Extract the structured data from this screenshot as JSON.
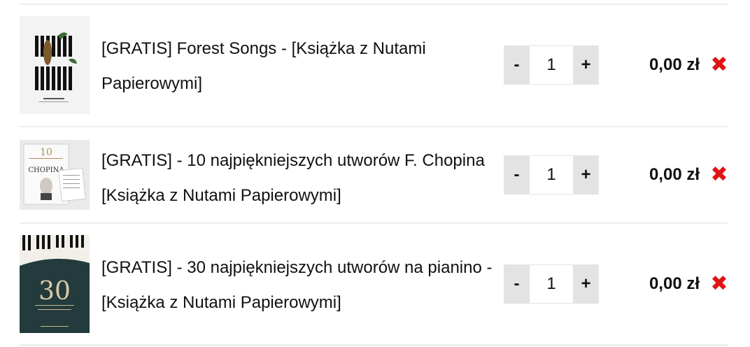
{
  "cart": {
    "items": [
      {
        "title": "[GRATIS] Forest Songs - [Książka z Nutami Papierowymi]",
        "quantity": "1",
        "price": "0,00 zł",
        "decrement": "-",
        "increment": "+",
        "remove": "✖",
        "thumbnail": "forest-songs-cover"
      },
      {
        "title": "[GRATIS] - 10 najpiękniejszych utworów F. Chopina [Książka z Nutami Papierowymi]",
        "quantity": "1",
        "price": "0,00 zł",
        "decrement": "-",
        "increment": "+",
        "remove": "✖",
        "thumbnail": "chopin-book-cover",
        "cover_text": "CHOPINA"
      },
      {
        "title": "[GRATIS] - 30 najpiękniejszych utworów na pianino - [Książka z Nutami Papierowymi]",
        "quantity": "1",
        "price": "0,00 zł",
        "decrement": "-",
        "increment": "+",
        "remove": "✖",
        "thumbnail": "30-pieces-book-cover",
        "cover_text": "30"
      }
    ],
    "colors": {
      "remove": "#e01414",
      "qty_button_bg": "#e3e3e3",
      "divider": "#ececec",
      "cover_30_bg": "#233b3c"
    }
  }
}
